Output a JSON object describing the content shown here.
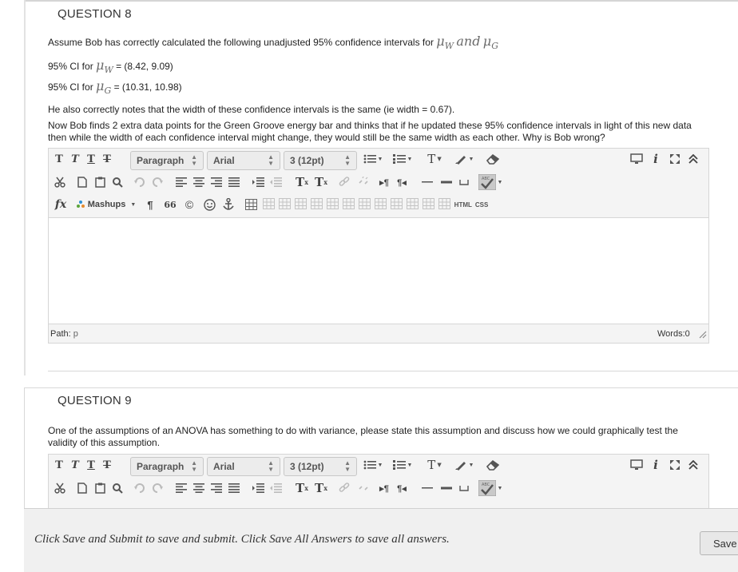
{
  "q8": {
    "title": "QUESTION 8",
    "intro": "Assume Bob has correctly calculated the following unadjusted 95% confidence intervals for ",
    "mu": "μ",
    "sub_w": "W",
    "and_word": "and",
    "sub_g": "G",
    "ci_prefix": "95% CI for ",
    "ci_w_value": " = (8.42, 9.09)",
    "ci_g_value": " = (10.31, 10.98)",
    "width_note": "He also correctly notes that the width of these confidence intervals is the same (ie width = 0.67).",
    "question": "Now Bob finds 2 extra data points for the Green Groove energy bar and thinks that if he updated these 95% confidence intervals in light of this new data then while the width of each confidence interval might change, they would still be the same width as each other. Why is Bob wrong?"
  },
  "editor": {
    "tb_t1": "T",
    "tb_t2": "T",
    "tb_t3": "T",
    "tb_t4": "T",
    "format_select": "Paragraph",
    "font_select": "Arial",
    "size_select": "3 (12pt)",
    "tb_textcolor": "T",
    "tb_info": "i",
    "tb_super": "T",
    "tb_sub": "T",
    "tb_fx": "fx",
    "mashups": "Mashups",
    "tb_pilcrow": "¶",
    "tb_quote": "66",
    "tb_copyright": "©",
    "tb_html": "HTML",
    "tb_css": "CSS",
    "path_label": "Path:",
    "path_value": "p",
    "words_label": "Words:",
    "words_value": "0"
  },
  "q9": {
    "title": "QUESTION 9",
    "question": "One of the assumptions of an ANOVA has something to do with variance, please state this assumption and discuss how we could graphically test the validity of this assumption."
  },
  "footer": {
    "instruction": "Click Save and Submit to save and submit. Click Save All Answers to save all answers.",
    "save_button": "Save All Answers"
  }
}
